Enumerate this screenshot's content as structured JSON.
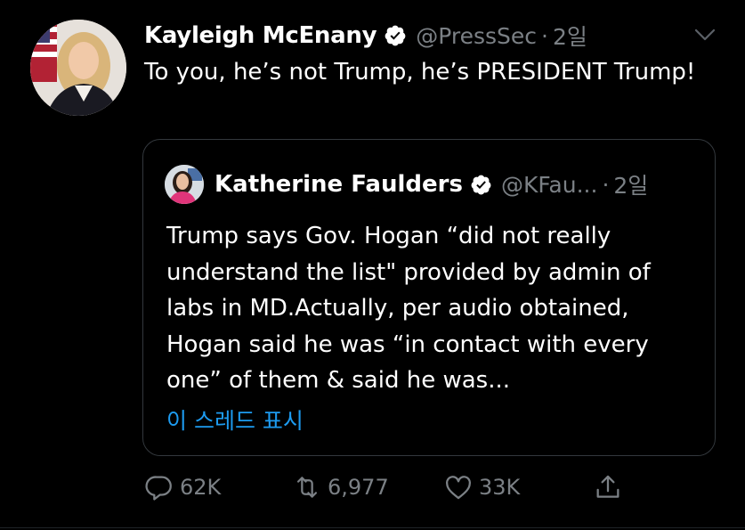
{
  "tweet": {
    "author_name": "Kayleigh McEnany",
    "handle": "@PressSec",
    "separator": "·",
    "time": "2일",
    "text": "To you, he’s not Trump, he’s PRESIDENT Trump!"
  },
  "quoted": {
    "author_name": "Katherine Faulders",
    "handle": "@KFau...",
    "separator": "·",
    "time": "2일",
    "text": "Trump says Gov. Hogan “did not really understand the list\" provided by admin of labs in MD.Actually, per audio obtained, Hogan said he was “in contact with every one” of them & said he was...",
    "show_thread_label": "이 스레드 표시"
  },
  "actions": {
    "reply_count": "62K",
    "retweet_count": "6,977",
    "like_count": "33K"
  },
  "colors": {
    "background": "#000000",
    "text": "#ffffff",
    "secondary": "#7b8085",
    "accent": "#1d9bf0",
    "border": "#33383d"
  },
  "icons": [
    "verified-badge-icon",
    "chevron-down-icon",
    "reply-icon",
    "retweet-icon",
    "like-icon",
    "share-icon"
  ]
}
